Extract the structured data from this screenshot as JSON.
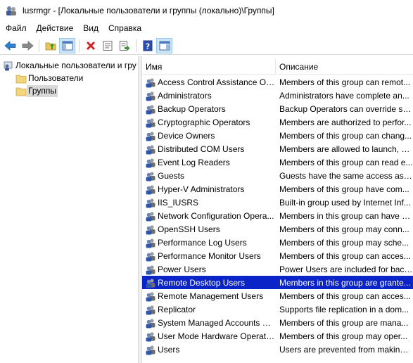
{
  "window": {
    "title": "lusrmgr - [Локальные пользователи и группы (локально)\\Группы]"
  },
  "menu": {
    "file": "Файл",
    "action": "Действие",
    "view": "Вид",
    "help": "Справка"
  },
  "toolbar": {
    "buttons": [
      "back-arrow-icon",
      "forward-arrow-icon",
      "up-folder-icon",
      "show-hide-tree-icon",
      "delete-icon",
      "properties-icon",
      "export-list-icon",
      "help-icon",
      "show-pane-icon"
    ]
  },
  "tree": {
    "root": "Локальные пользователи и гру",
    "users": "Пользователи",
    "groups": "Группы"
  },
  "list": {
    "col_name": "Имя",
    "col_desc": "Описание",
    "rows": [
      {
        "name": "Access Control Assistance Op...",
        "desc": "Members of this group can remot..."
      },
      {
        "name": "Administrators",
        "desc": "Administrators have complete an..."
      },
      {
        "name": "Backup Operators",
        "desc": "Backup Operators can override se..."
      },
      {
        "name": "Cryptographic Operators",
        "desc": "Members are authorized to perfor..."
      },
      {
        "name": "Device Owners",
        "desc": "Members of this group can chang..."
      },
      {
        "name": "Distributed COM Users",
        "desc": "Members are allowed to launch, a..."
      },
      {
        "name": "Event Log Readers",
        "desc": "Members of this group can read e..."
      },
      {
        "name": "Guests",
        "desc": "Guests have the same access as m..."
      },
      {
        "name": "Hyper-V Administrators",
        "desc": "Members of this group have com..."
      },
      {
        "name": "IIS_IUSRS",
        "desc": "Built-in group used by Internet Inf..."
      },
      {
        "name": "Network Configuration Opera...",
        "desc": "Members in this group can have s..."
      },
      {
        "name": "OpenSSH Users",
        "desc": "Members of this group may conn..."
      },
      {
        "name": "Performance Log Users",
        "desc": "Members of this group may sche..."
      },
      {
        "name": "Performance Monitor Users",
        "desc": "Members of this group can acces..."
      },
      {
        "name": "Power Users",
        "desc": "Power Users are included for back..."
      },
      {
        "name": "Remote Desktop Users",
        "desc": "Members in this group are grante..."
      },
      {
        "name": "Remote Management Users",
        "desc": "Members of this group can acces..."
      },
      {
        "name": "Replicator",
        "desc": "Supports file replication in a dom..."
      },
      {
        "name": "System Managed Accounts G...",
        "desc": "Members of this group are mana..."
      },
      {
        "name": "User Mode Hardware Operators",
        "desc": "Members of this group may oper..."
      },
      {
        "name": "Users",
        "desc": "Users are prevented from making ..."
      }
    ],
    "selected_index": 15,
    "selection_color": "#0a24c8"
  }
}
